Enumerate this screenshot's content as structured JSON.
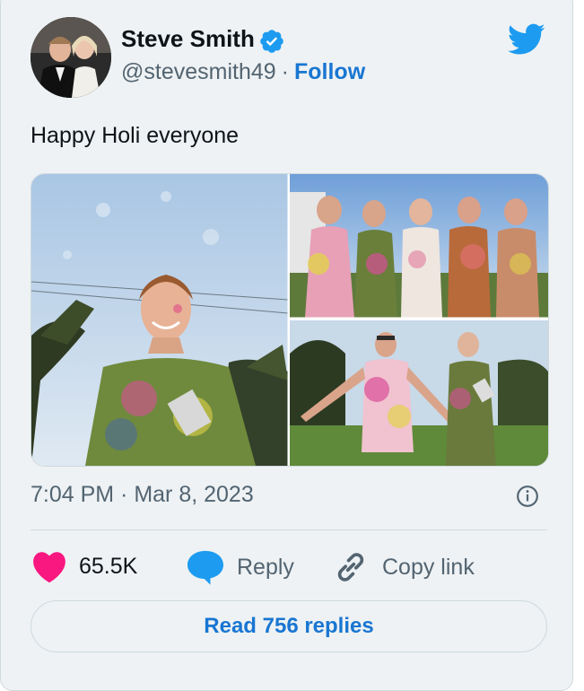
{
  "author": {
    "name": "Steve Smith",
    "handle": "@stevesmith49",
    "separator": "·",
    "follow_label": "Follow",
    "verified": true
  },
  "tweet": {
    "text": "Happy Holi everyone",
    "timestamp": "7:04 PM · Mar 8, 2023"
  },
  "media": {
    "photos": [
      {
        "description": "man in colourful holi-stained t-shirt outdoors"
      },
      {
        "description": "group of five men covered in holi colours"
      },
      {
        "description": "two men in holi-stained shirts on grass"
      }
    ]
  },
  "actions": {
    "likes_count": "65.5K",
    "reply_label": "Reply",
    "copy_link_label": "Copy link"
  },
  "footer": {
    "read_replies_label": "Read 756 replies"
  },
  "colors": {
    "accent": "#1976d2",
    "like": "#f91880",
    "twitter_blue": "#1d9bf0",
    "card_bg": "#eef2f4"
  },
  "icons": [
    "twitter-bird-icon",
    "verified-badge-icon",
    "info-icon",
    "heart-icon",
    "reply-bubble-icon",
    "link-icon"
  ]
}
